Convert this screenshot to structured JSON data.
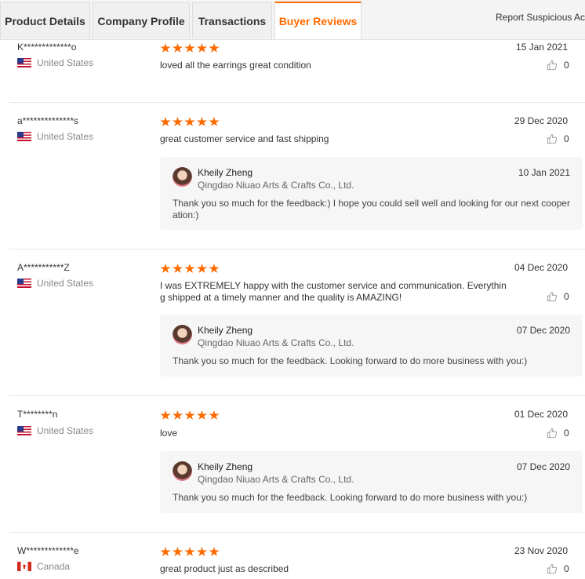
{
  "tabs": [
    {
      "label": "Product Details"
    },
    {
      "label": "Company Profile"
    },
    {
      "label": "Transactions"
    },
    {
      "label": "Buyer Reviews"
    }
  ],
  "report_link": "Report Suspicious Activity",
  "colors": {
    "accent": "#ff6a00",
    "divider": "#e6e6e6",
    "reply_bg": "#f6f6f6"
  },
  "reviews": [
    {
      "buyer": "K*************o",
      "country": "United States",
      "rating": 5,
      "date": "15 Jan 2021",
      "comment": "loved all the earrings great condition",
      "likes": "0"
    },
    {
      "buyer": "a**************s",
      "country": "United States",
      "rating": 5,
      "date": "29 Dec 2020",
      "comment": "great customer service and fast shipping",
      "likes": "0",
      "reply": {
        "name": "Kheily Zheng",
        "company": "Qingdao Niuao Arts & Crafts Co., Ltd.",
        "date": "10 Jan 2021",
        "text": "Thank you so much for the feedback:) I hope you could sell well and looking for our next cooperation:)"
      }
    },
    {
      "buyer": "A***********Z",
      "country": "United States",
      "rating": 5,
      "date": "04 Dec 2020",
      "comment": "I was EXTREMELY happy with the customer service and communication. Everything shipped at a timely manner and the quality is AMAZING!",
      "likes": "0",
      "reply": {
        "name": "Kheily Zheng",
        "company": "Qingdao Niuao Arts & Crafts Co., Ltd.",
        "date": "07 Dec 2020",
        "text": "Thank you so much for the feedback. Looking forward to do more business with you:)"
      }
    },
    {
      "buyer": "T********n",
      "country": "United States",
      "rating": 5,
      "date": "01 Dec 2020",
      "comment": "love",
      "likes": "0",
      "reply": {
        "name": "Kheily Zheng",
        "company": "Qingdao Niuao Arts & Crafts Co., Ltd.",
        "date": "07 Dec 2020",
        "text": "Thank you so much for the feedback. Looking forward to do more business with you:)"
      }
    },
    {
      "buyer": "W*************e",
      "country": "Canada",
      "rating": 5,
      "date": "23 Nov 2020",
      "comment": "great product just as described",
      "likes": "0"
    }
  ]
}
